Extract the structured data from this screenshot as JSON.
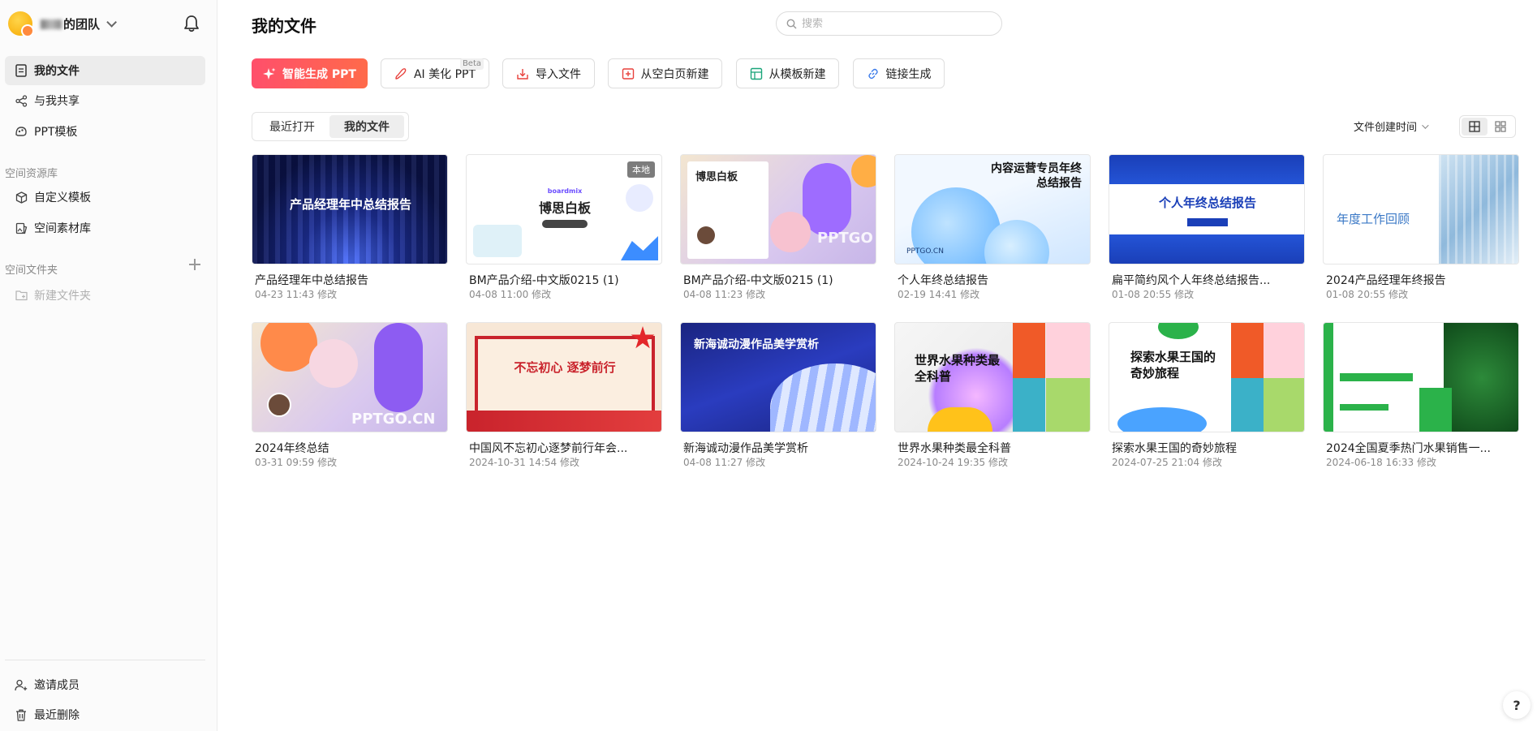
{
  "team": {
    "name": "的团队"
  },
  "sidebar": {
    "items": [
      {
        "label": "我的文件",
        "icon": "file-icon"
      },
      {
        "label": "与我共享",
        "icon": "share-icon"
      },
      {
        "label": "PPT模板",
        "icon": "template-icon"
      }
    ],
    "library_label": "空间资源库",
    "library_items": [
      {
        "label": "自定义模板",
        "icon": "cube-icon"
      },
      {
        "label": "空间素材库",
        "icon": "image-library-icon"
      }
    ],
    "folder_label": "空间文件夹",
    "new_folder_label": "新建文件夹",
    "bottom_items": [
      {
        "label": "邀请成员",
        "icon": "invite-user-icon"
      },
      {
        "label": "最近删除",
        "icon": "trash-icon"
      }
    ]
  },
  "header": {
    "title": "我的文件",
    "search_placeholder": "搜索"
  },
  "toolbar": {
    "buttons": [
      {
        "label": "智能生成 PPT",
        "icon": "sparkle-icon"
      },
      {
        "label": "AI 美化 PPT",
        "icon": "brush-icon",
        "badge": "Beta"
      },
      {
        "label": "导入文件",
        "icon": "import-icon"
      },
      {
        "label": "从空白页新建",
        "icon": "blank-page-icon"
      },
      {
        "label": "从模板新建",
        "icon": "template-new-icon"
      },
      {
        "label": "链接生成",
        "icon": "link-icon"
      }
    ]
  },
  "tabs": [
    {
      "label": "最近打开"
    },
    {
      "label": "我的文件"
    }
  ],
  "sort": {
    "label": "文件创建时间"
  },
  "files": [
    {
      "name": "产品经理年中总结报告",
      "time": "04-23 11:43 修改",
      "thumb_title": "产品经理年中总结报告"
    },
    {
      "name": "BM产品介绍-中文版0215 (1)",
      "time": "04-08 11:00 修改",
      "thumb_title": "博思白板",
      "thumb_brand": "boardmix",
      "badge": "本地"
    },
    {
      "name": "BM产品介绍-中文版0215 (1)",
      "time": "04-08 11:23 修改",
      "thumb_title": "博思白板",
      "thumb_wm": "PPTGO"
    },
    {
      "name": "个人年终总结报告",
      "time": "02-19 14:41 修改",
      "thumb_title": "内容运营专员年终总结报告",
      "thumb_wm": "PPTGO.CN"
    },
    {
      "name": "扁平简约风个人年终总结报告...",
      "time": "01-08 20:55 修改",
      "thumb_title": "个人年终总结报告"
    },
    {
      "name": "2024产品经理年终报告",
      "time": "01-08 20:55 修改",
      "thumb_title": "年度工作回顾"
    },
    {
      "name": "2024年终总结",
      "time": "03-31 09:59 修改",
      "thumb_wm": "PPTGO.CN"
    },
    {
      "name": "中国风不忘初心逐梦前行年会...",
      "time": "2024-10-31 14:54 修改",
      "thumb_title": "不忘初心 逐梦前行"
    },
    {
      "name": "新海诚动漫作品美学赏析",
      "time": "04-08 11:27 修改",
      "thumb_title": "新海诚动漫作品美学赏析"
    },
    {
      "name": "世界水果种类最全科普",
      "time": "2024-10-24 19:35 修改",
      "thumb_title": "世界水果种类最全科普"
    },
    {
      "name": "探索水果王国的奇妙旅程",
      "time": "2024-07-25 21:04 修改",
      "thumb_title": "探索水果王国的奇妙旅程"
    },
    {
      "name": "2024全国夏季热门水果销售一...",
      "time": "2024-06-18 16:33 修改"
    }
  ],
  "colors": {
    "primary_gradient_start": "#ff4f6b",
    "primary_gradient_end": "#ff6a4a"
  }
}
